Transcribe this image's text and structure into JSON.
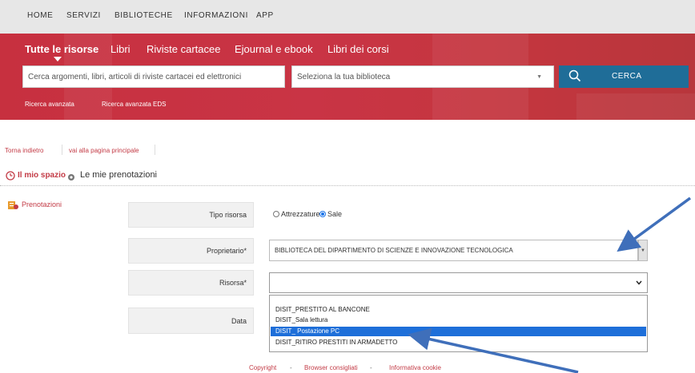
{
  "topnav": {
    "items": [
      "HOME",
      "SERVIZI",
      "BIBLIOTECHE",
      "INFORMAZIONI",
      "APP"
    ]
  },
  "search": {
    "tabs": [
      "Tutte le risorse",
      "Libri",
      "Riviste cartacee",
      "Ejournal e ebook",
      "Libri dei corsi"
    ],
    "input_placeholder": "Cerca argomenti, libri, articoli di riviste cartacei ed elettronici",
    "library_select": "Seleziona la tua biblioteca",
    "button_label": "CERCA",
    "advanced_links": [
      "Ricerca avanzata",
      "Ricerca avanzata EDS"
    ]
  },
  "breadcrumb": {
    "back": "Torna indietro",
    "home": "vai alla pagina principale"
  },
  "section": {
    "my_space": "Il mio spazio",
    "title": "Le mie prenotazioni"
  },
  "sidebar": {
    "link": "Prenotazioni"
  },
  "form": {
    "tipo_label": "Tipo risorsa",
    "tipo_options": [
      "Attrezzature",
      "Sale"
    ],
    "tipo_selected": "Sale",
    "proprietario_label": "Proprietario*",
    "proprietario_value": "BIBLIOTECA DEL DIPARTIMENTO DI SCIENZE E INNOVAZIONE TECNOLOGICA",
    "risorsa_label": "Risorsa*",
    "risorsa_value": "",
    "data_label": "Data",
    "risorsa_options": [
      "DISIT_PRESTITO AL BANCONE",
      "DISIT_Sala lettura",
      "DISIT_ Postazione PC",
      "DISIT_RITIRO PRESTITI IN ARMADETTO"
    ],
    "highlighted_option": "DISIT_ Postazione PC"
  },
  "footer": {
    "links": [
      "Copyright",
      "Browser consigliati",
      "Informativa cookie"
    ],
    "separator": "-"
  },
  "colors": {
    "brand_red": "#c93445",
    "search_blue": "#1f6d98",
    "link_red": "#c33b46",
    "highlight_blue": "#1e6fd9",
    "annotation_arrow": "#3f6fba"
  }
}
